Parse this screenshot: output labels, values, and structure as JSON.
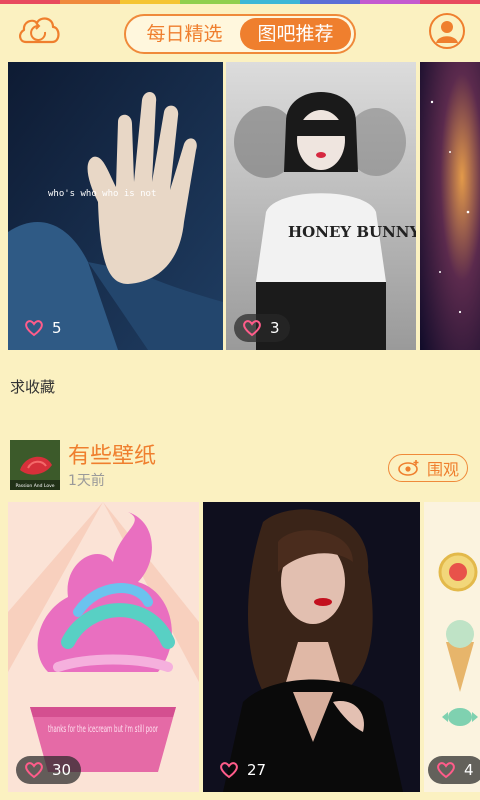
{
  "colors": {
    "accent": "#ef7f2e",
    "background": "#fbf1c1",
    "rainbow": [
      "#e84a5f",
      "#f08a3c",
      "#f5c531",
      "#8fcf4e",
      "#3cb8d6",
      "#5b6fd6",
      "#c45ad0",
      "#e84a5f"
    ]
  },
  "header": {
    "left_icon": "cloud-refresh-icon",
    "tabs": [
      {
        "label": "每日精选",
        "active": false
      },
      {
        "label": "图吧推荐",
        "active": true
      }
    ],
    "right_icon": "user-avatar-icon"
  },
  "gallery_top": {
    "items": [
      {
        "likes": "5",
        "overlay_text": "who's who who is not"
      },
      {
        "likes": "3",
        "overlay_text": "HONEY BUNNY"
      },
      {
        "likes": ""
      }
    ],
    "caption": "求收藏"
  },
  "post": {
    "thumb_text": "Passion And Love",
    "title": "有些壁纸",
    "time": "1天前",
    "watch_label": "围观",
    "watch_icon": "eye-plus-icon",
    "items": [
      {
        "likes": "30",
        "overlay_text": "thanks for the icecream but i'm still poor"
      },
      {
        "likes": "27"
      },
      {
        "likes": "4"
      }
    ]
  }
}
